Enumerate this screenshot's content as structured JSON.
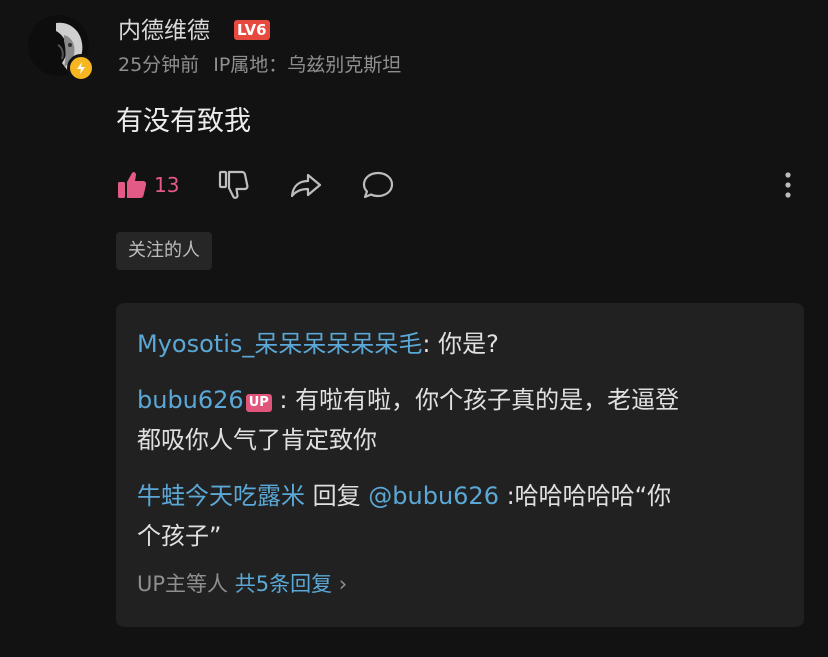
{
  "comment": {
    "username": "内德维德",
    "level_badge": "LV6",
    "time_ago": "25分钟前",
    "ip_location": "IP属地：乌兹别克斯坦",
    "text": "有没有致我",
    "like_count": "13",
    "tag": "关注的人"
  },
  "replies": [
    {
      "author": "Myosotis_呆呆呆呆呆呆毛",
      "text": ": 你是?"
    },
    {
      "author": "bubu626",
      "badge": "UP",
      "text_line1": " : 有啦有啦，你个孩子真的是，老逼登",
      "text_line2": "都吸你人气了肯定致你"
    },
    {
      "author": "牛蛙今天吃露米",
      "reply_word": " 回复 ",
      "mention": "@bubu626",
      "text_line1": " :哈哈哈哈哈“你",
      "text_line2": "个孩子”"
    }
  ],
  "summary": {
    "prefix": "UP主等人",
    "total": "共5条回复",
    "chevron": "›"
  },
  "icons": {
    "like": "thumbs-up-icon",
    "dislike": "thumbs-down-icon",
    "share": "share-icon",
    "reply": "reply-bubble-icon",
    "more": "more-vertical-icon",
    "badge": "lightning-icon"
  },
  "colors": {
    "background": "#121212",
    "panel": "#212121",
    "link_blue": "#5ba8d6",
    "like_pink": "#e35a87",
    "level_red": "#e8493f",
    "badge_yellow": "#f5b621"
  }
}
